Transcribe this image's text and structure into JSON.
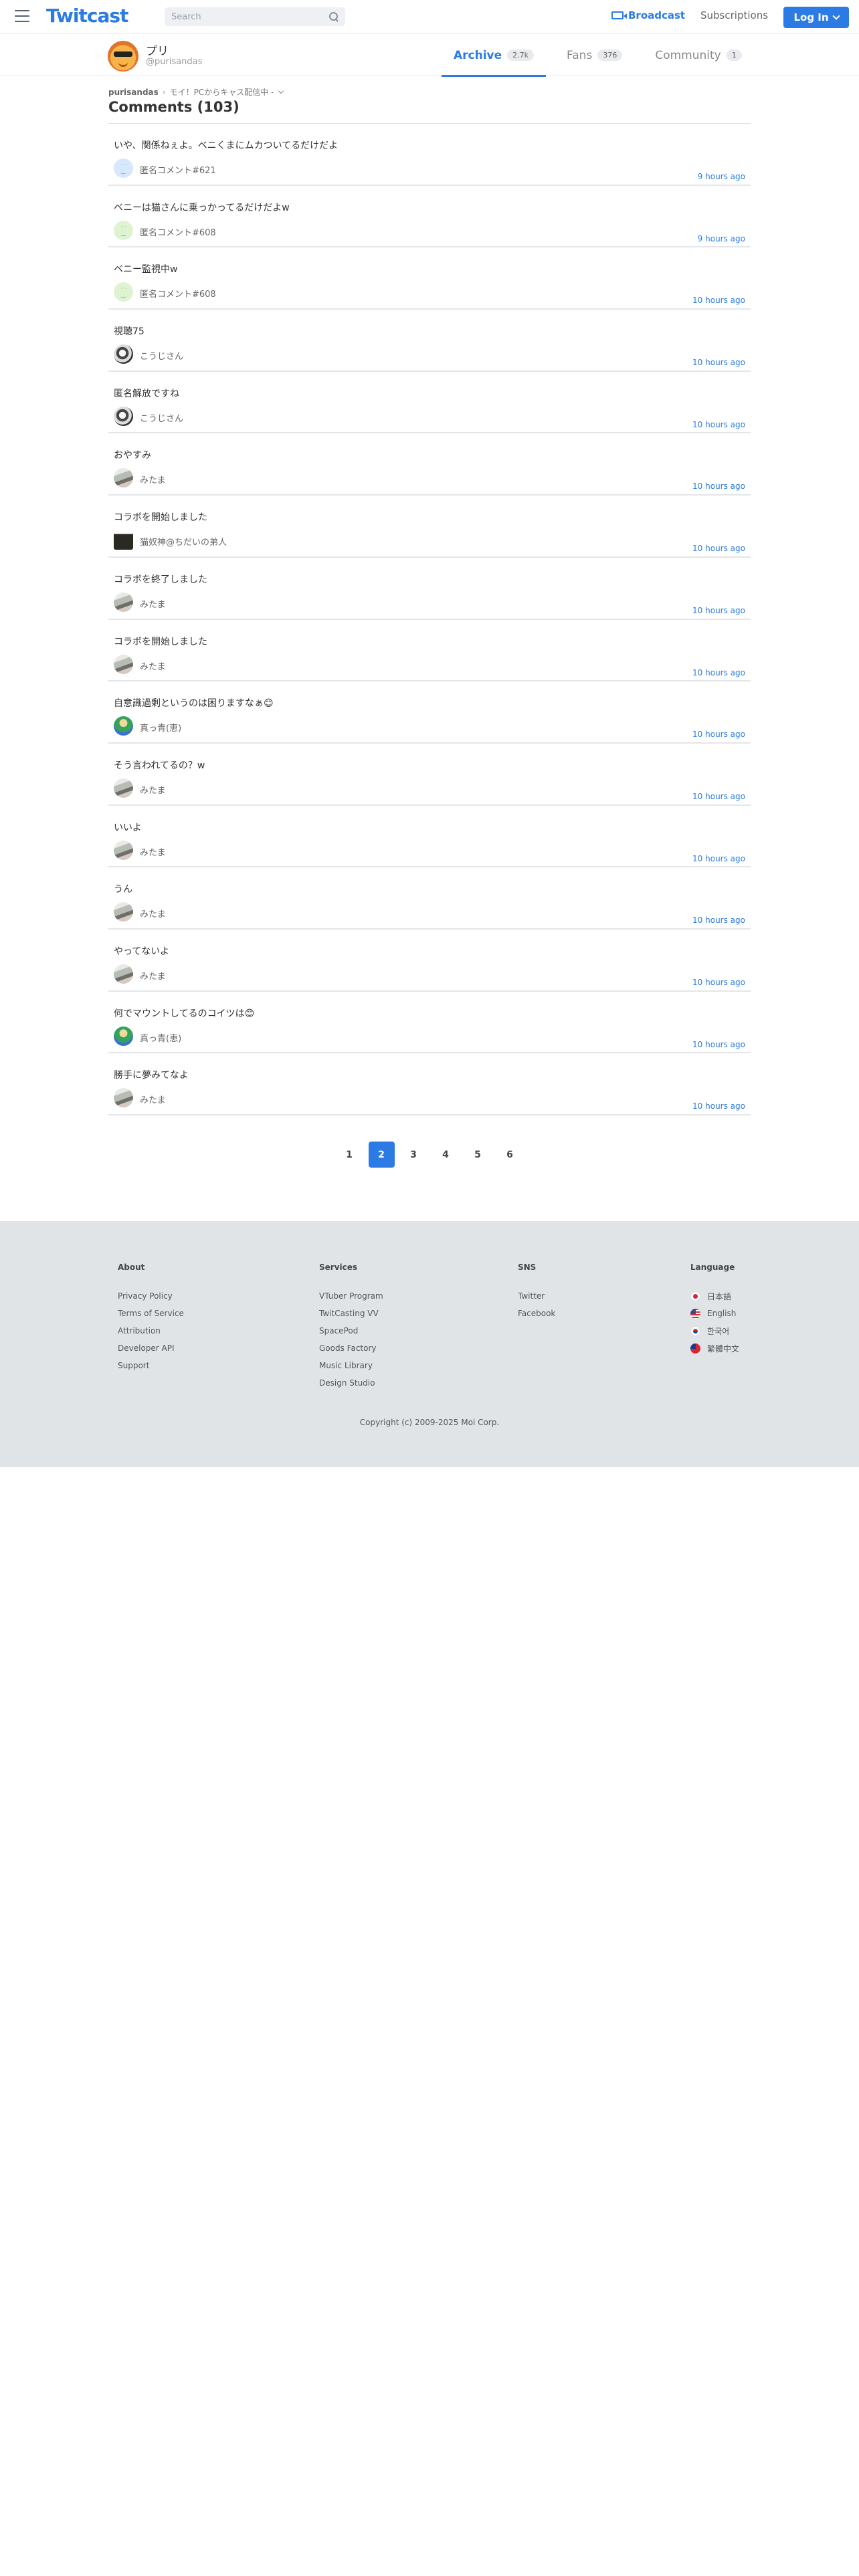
{
  "header": {
    "logo": "Twitcast",
    "search_placeholder": "Search",
    "broadcast": "Broadcast",
    "subscriptions": "Subscriptions",
    "login": "Log In"
  },
  "profile": {
    "name": "プリ",
    "id": "@purisandas",
    "tabs": [
      {
        "label": "Archive",
        "count": "2.7k"
      },
      {
        "label": "Fans",
        "count": "376"
      },
      {
        "label": "Community",
        "count": "1"
      }
    ]
  },
  "breadcrumb": {
    "user": "purisandas",
    "separator": "›",
    "movie": "モイ！PCからキャス配信中 -"
  },
  "page_title": "Comments (103)",
  "comments": [
    {
      "text": "いや、関係ねぇよ。ベニくまにムカついてるだけだよ",
      "user": "匿名コメント#621",
      "time": "9 hours ago",
      "avatar": "anon-blue"
    },
    {
      "text": "ベニーは猫さんに乗っかってるだけだよw",
      "user": "匿名コメント#608",
      "time": "9 hours ago",
      "avatar": "anon-green"
    },
    {
      "text": "ベニー監視中w",
      "user": "匿名コメント#608",
      "time": "10 hours ago",
      "avatar": "anon-green"
    },
    {
      "text": "視聴75",
      "user": "こうじさん",
      "time": "10 hours ago",
      "avatar": "kouji"
    },
    {
      "text": "匿名解放ですね",
      "user": "こうじさん",
      "time": "10 hours ago",
      "avatar": "kouji"
    },
    {
      "text": "おやすみ",
      "user": "みたま",
      "time": "10 hours ago",
      "avatar": "mitama"
    },
    {
      "text": "コラボを開始しました",
      "user": "猫奴神@ちだいの弟人",
      "time": "10 hours ago",
      "avatar": "neko"
    },
    {
      "text": "コラボを終了しました",
      "user": "みたま",
      "time": "10 hours ago",
      "avatar": "mitama"
    },
    {
      "text": "コラボを開始しました",
      "user": "みたま",
      "time": "10 hours ago",
      "avatar": "mitama"
    },
    {
      "text": "自意識過剰というのは困りますなぁ😊",
      "user": "真っ青(恵)",
      "time": "10 hours ago",
      "avatar": "mako"
    },
    {
      "text": "そう言われてるの？w",
      "user": "みたま",
      "time": "10 hours ago",
      "avatar": "mitama"
    },
    {
      "text": "いいよ",
      "user": "みたま",
      "time": "10 hours ago",
      "avatar": "mitama"
    },
    {
      "text": "うん",
      "user": "みたま",
      "time": "10 hours ago",
      "avatar": "mitama"
    },
    {
      "text": "やってないよ",
      "user": "みたま",
      "time": "10 hours ago",
      "avatar": "mitama"
    },
    {
      "text": "何でマウントしてるのコイツは😊",
      "user": "真っ青(恵)",
      "time": "10 hours ago",
      "avatar": "mako"
    },
    {
      "text": "勝手に夢みてなよ",
      "user": "みたま",
      "time": "10 hours ago",
      "avatar": "mitama"
    }
  ],
  "pagination": {
    "pages": [
      "1",
      "2",
      "3",
      "4",
      "5",
      "6"
    ],
    "current": "2"
  },
  "footer": {
    "about": {
      "heading": "About",
      "links": [
        "Privacy Policy",
        "Terms of Service",
        "Attribution",
        "Developer API",
        "Support"
      ]
    },
    "services": {
      "heading": "Services",
      "links": [
        "VTuber Program",
        "TwitCasting VV",
        "SpacePod",
        "Goods Factory",
        "Music Library",
        "Design Studio"
      ]
    },
    "sns": {
      "heading": "SNS",
      "links": [
        "Twitter",
        "Facebook"
      ]
    },
    "language": {
      "heading": "Language",
      "links": [
        {
          "label": "日本語",
          "flag": "jp"
        },
        {
          "label": "English",
          "flag": "us"
        },
        {
          "label": "한국어",
          "flag": "kr"
        },
        {
          "label": "繁體中文",
          "flag": "tw"
        }
      ]
    },
    "copyright": "Copyright (c) 2009-2025 Moi Corp."
  }
}
